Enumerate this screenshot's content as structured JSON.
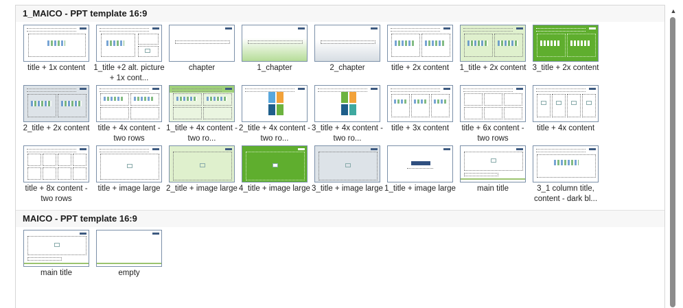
{
  "sections": [
    {
      "title": "1_MAICO - PPT template 16:9",
      "layouts": [
        "title + 1x content",
        "1_title +2 alt. picture + 1x cont...",
        "chapter",
        "1_chapter",
        "2_chapter",
        "title + 2x content",
        "1_title + 2x content",
        "3_title + 2x content",
        "2_title + 2x content",
        "title + 4x content - two rows",
        "1_title + 4x content - two ro...",
        "2_title + 4x content - two ro...",
        "3_title + 4x content - two ro...",
        "title + 3x content",
        "title + 6x content - two rows",
        "title + 4x content",
        "title + 8x content - two rows",
        "title + image large",
        "2_title + image large",
        "4_title + image large",
        "3_title + image large",
        "1_title + image large",
        "main title",
        "3_1 column title, content - dark bl..."
      ]
    },
    {
      "title": "MAICO - PPT template 16:9",
      "layouts": [
        "main title",
        "empty"
      ]
    }
  ],
  "colors": {
    "accent_green": "#5fae2e",
    "thumb_border": "#7a8fa8",
    "scroll_thumb": "#8c8c8c"
  },
  "icons": {
    "scroll_up": "scroll-up-arrow-icon"
  }
}
